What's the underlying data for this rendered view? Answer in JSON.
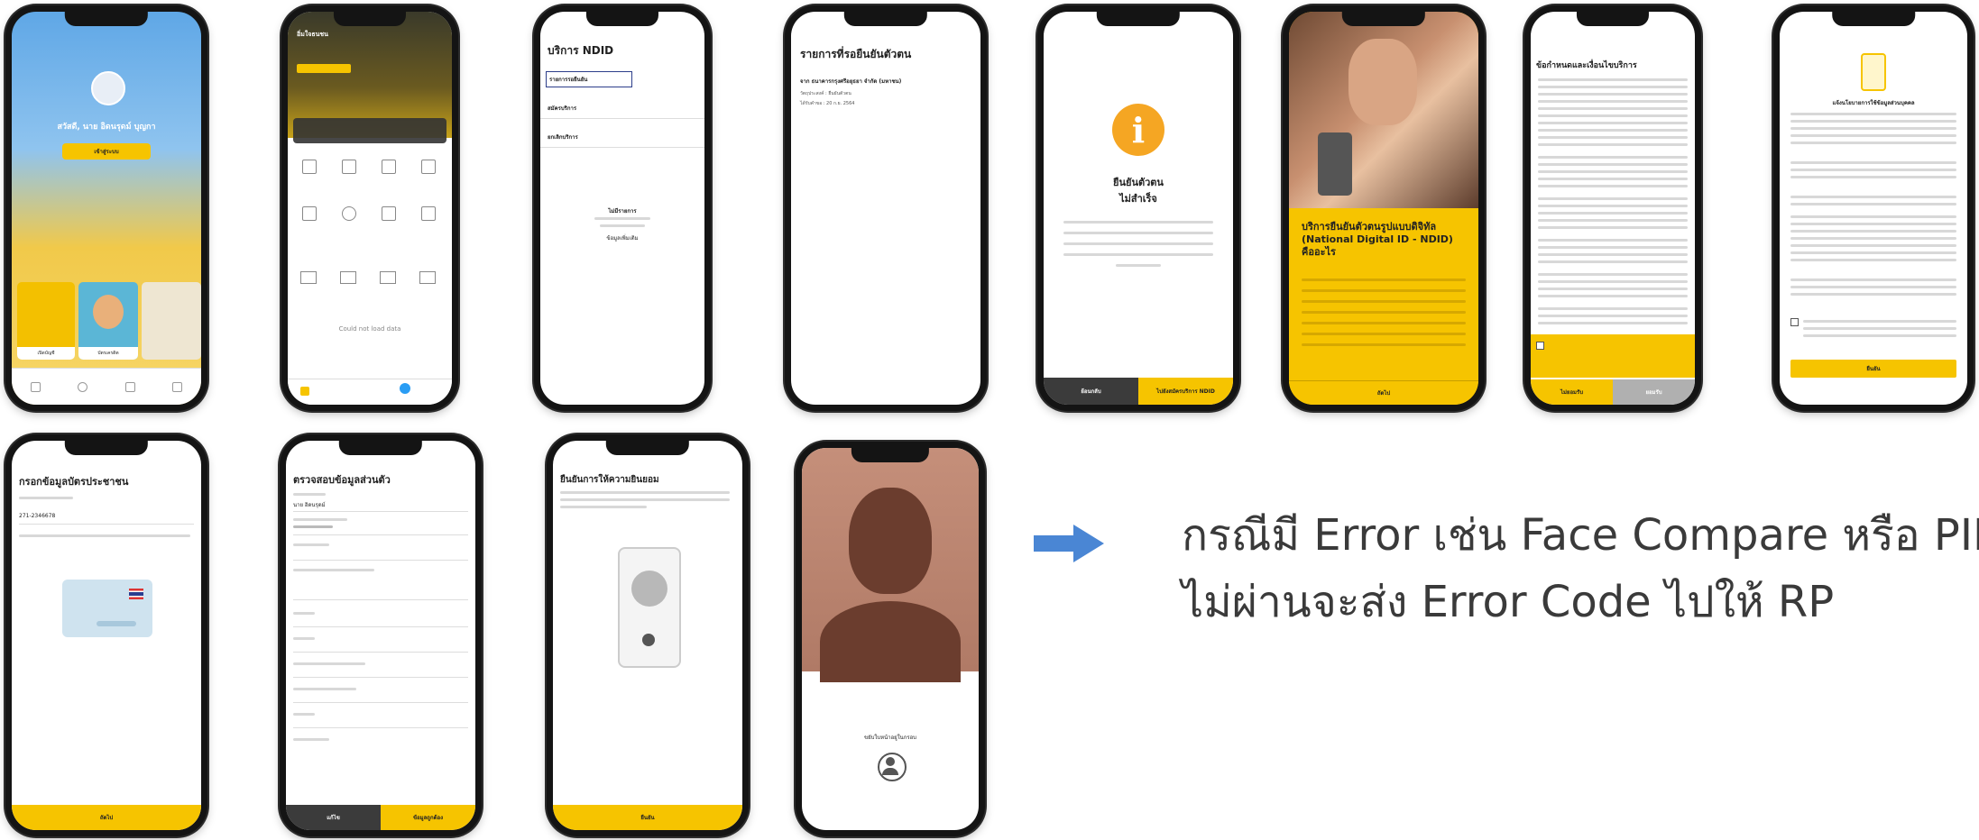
{
  "caption": {
    "line1": "กรณีมี Error เช่น Face Compare หรือ PIN",
    "line2": "ไม่ผ่านจะส่ง Error Code ไปให้ RP"
  },
  "colors": {
    "accent": "#f6c400",
    "arrow": "#4a86d4",
    "text": "#3a3a3a"
  },
  "phones": {
    "p1": {
      "greeting": "สวัสดี, นาย อิดนรุดม์ บุญกา",
      "login": "เข้าสู่ระบบ",
      "card_left": "เปิดบัญชี",
      "card_right": "บัตรเครดิต"
    },
    "p2": {
      "bank_name": "อิ่มใจธนชน",
      "load_failed": "Could not load data"
    },
    "p3": {
      "title": "บริการ NDID",
      "item1": "รายการรอยืนยัน",
      "item2": "สมัครบริการ",
      "item3": "ยกเลิกบริการ",
      "empty_title": "ไม่มีรายการ",
      "empty_link": "ข้อมูลเพิ่มเติม"
    },
    "p4": {
      "title": "รายการที่รอยืนยันตัวตน",
      "req_from": "จาก ธนาคารกรุงศรีอยุธยา จำกัด (มหาชน)",
      "req_line2": "วัตถุประสงค์ : ยืนยันตัวตน",
      "req_line3": "ได้รับคำขอ : 20 ก.ย. 2564"
    },
    "p5": {
      "title1": "ยืนยันตัวตน",
      "title2": "ไม่สำเร็จ",
      "icon_text": "i",
      "btn_left": "ย้อนกลับ",
      "btn_right": "ไปยังสมัครบริการ NDID"
    },
    "p6": {
      "headline": "บริการยืนยันตัวตนรูปแบบดิจิทัล (National Digital ID - NDID) คืออะไร",
      "btn": "ถัดไป"
    },
    "p7": {
      "title": "ข้อกำหนดและเงื่อนไขบริการ",
      "btn_left": "ไม่ยอมรับ",
      "btn_right": "ยอมรับ"
    },
    "p8": {
      "title": "แจ้งนโยบายการใช้ข้อมูลส่วนบุคคล",
      "btn": "ยืนยัน"
    },
    "p9": {
      "title": "กรอกข้อมูลบัตรประชาชน",
      "id_value": "271-2346678",
      "btn": "ถัดไป"
    },
    "p10": {
      "title": "ตรวจสอบข้อมูลส่วนตัว",
      "name_value": "นาย อิดนรุดม์",
      "btn_left": "แก้ไข",
      "btn_right": "ข้อมูลถูกต้อง"
    },
    "p11": {
      "title": "ยืนยันการให้ความยินยอม",
      "btn": "ยืนยัน"
    },
    "p12": {
      "hint": "ขยับใบหน้าอยู่ในกรอบ"
    }
  }
}
